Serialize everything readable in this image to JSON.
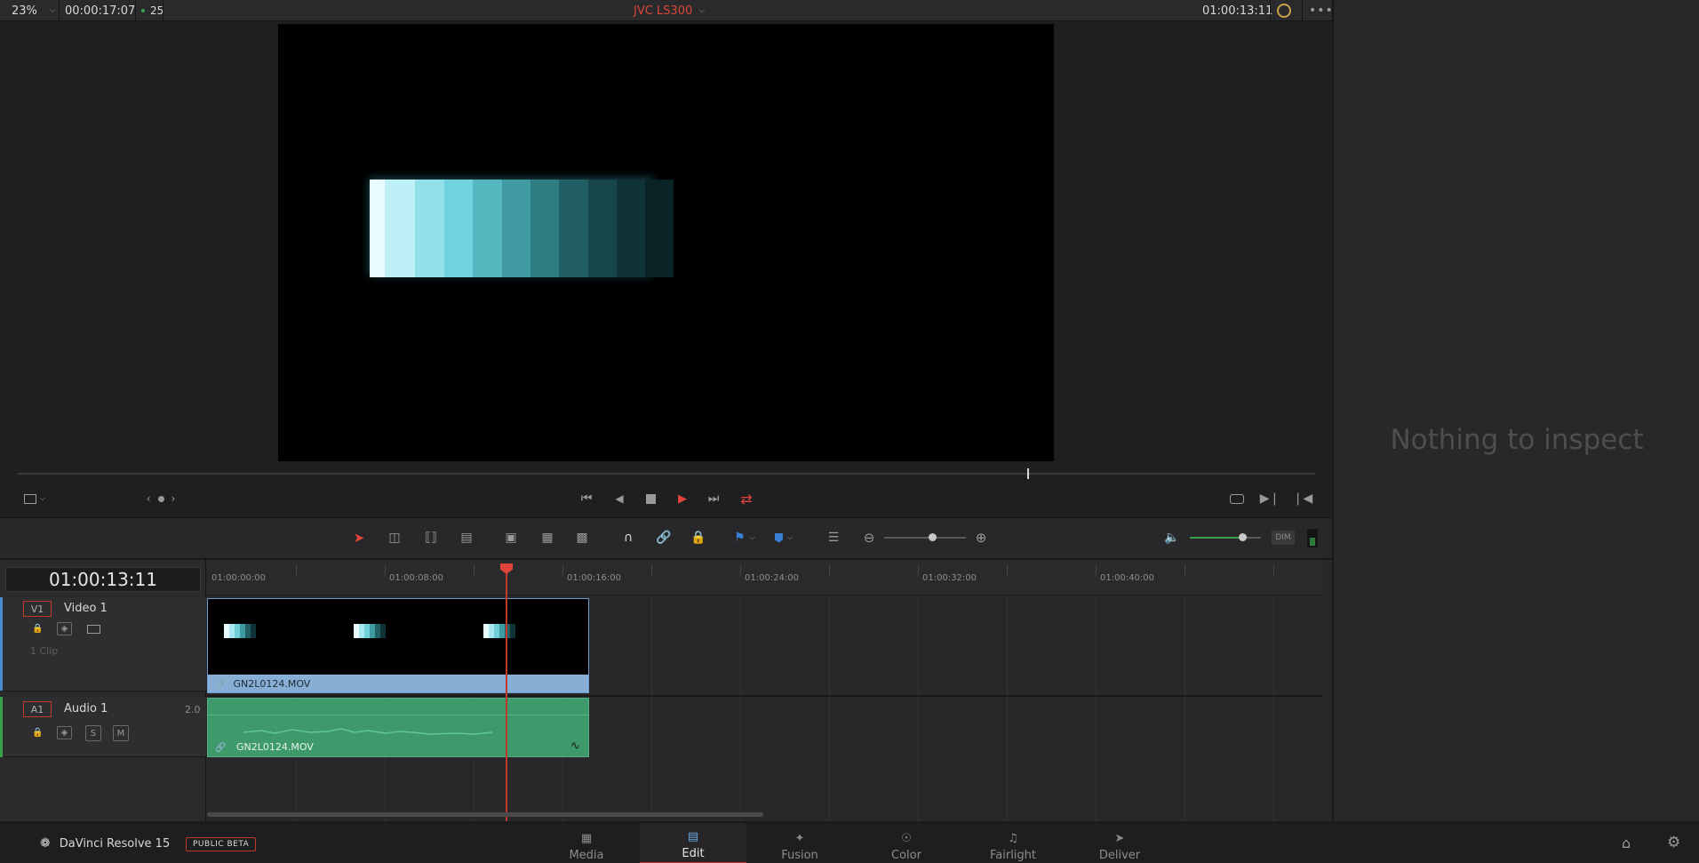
{
  "topbar": {
    "zoom": "23%",
    "duration": "00:00:17:07",
    "fps": "25",
    "clip_name": "JVC LS300",
    "timecode": "01:00:13:11"
  },
  "inspector": {
    "empty_text": "Nothing to inspect"
  },
  "timeline": {
    "timecode": "01:00:13:11",
    "ruler_labels": [
      "01:00:00:00",
      "01:00:08:00",
      "01:00:16:00",
      "01:00:24:00",
      "01:00:32:00",
      "01:00:40:00"
    ],
    "tracks": {
      "video": {
        "badge": "V1",
        "name": "Video 1",
        "clip_count": "1 Clip",
        "clip_name": "GN2L0124.MOV"
      },
      "audio": {
        "badge": "A1",
        "name": "Audio 1",
        "channels": "2.0",
        "solo": "S",
        "mute": "M",
        "clip_name": "GN2L0124.MOV"
      }
    }
  },
  "toolbar": {
    "dim_label": "DIM"
  },
  "bottombar": {
    "app_name": "DaVinci Resolve 15",
    "beta_badge": "PUBLIC BETA",
    "tabs": [
      {
        "label": "Media",
        "icon": "media-icon"
      },
      {
        "label": "Edit",
        "icon": "edit-icon"
      },
      {
        "label": "Fusion",
        "icon": "fusion-icon"
      },
      {
        "label": "Color",
        "icon": "color-icon"
      },
      {
        "label": "Fairlight",
        "icon": "fairlight-icon"
      },
      {
        "label": "Deliver",
        "icon": "deliver-icon"
      }
    ],
    "active_tab": "Edit"
  },
  "colors": {
    "accent": "#c0392b",
    "video_clip": "#87aed4",
    "audio_clip": "#3f9a6b",
    "audio_meter": "#3aa04a"
  }
}
